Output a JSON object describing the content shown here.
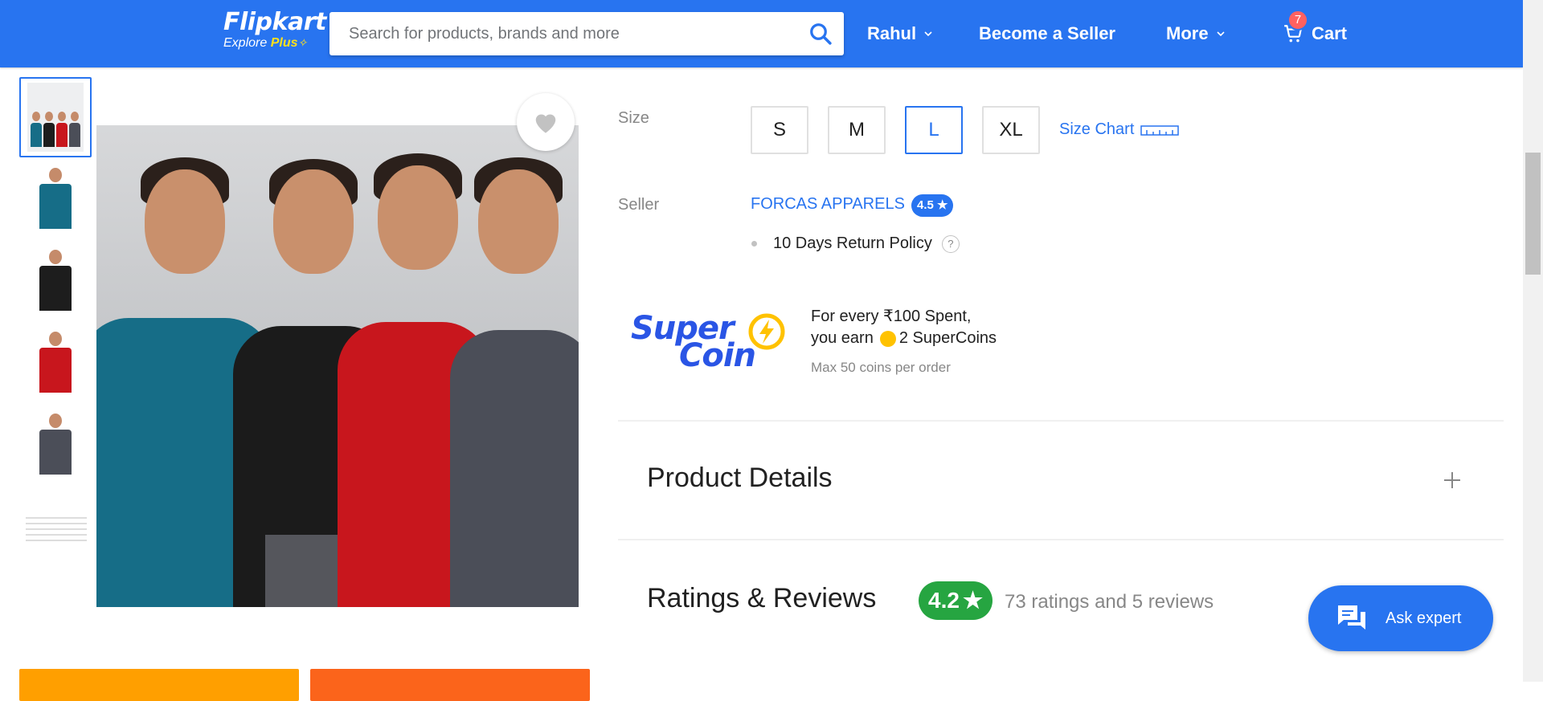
{
  "header": {
    "logo_main": "Flipkart",
    "logo_sub_prefix": "Explore",
    "logo_sub_plus": "Plus",
    "search_placeholder": "Search for products, brands and more",
    "user_label": "Rahul",
    "seller_label": "Become a Seller",
    "more_label": "More",
    "cart_label": "Cart",
    "cart_count": "7"
  },
  "product": {
    "size_label": "Size",
    "sizes": [
      "S",
      "M",
      "L",
      "XL"
    ],
    "selected_size": "L",
    "size_chart_label": "Size Chart",
    "seller_label": "Seller",
    "seller_name": "FORCAS APPARELS",
    "seller_rating": "4.5",
    "return_policy": "10 Days Return Policy",
    "help_icon_text": "?"
  },
  "supercoin": {
    "brand_line1": "Super",
    "brand_line2": "Coin",
    "line1": "For every ₹100 Spent,",
    "line2_prefix": "you earn",
    "line2_suffix": "2 SuperCoins",
    "note": "Max 50 coins per order"
  },
  "sections": {
    "product_details": "Product Details",
    "ratings_reviews": "Ratings & Reviews",
    "overall_rating": "4.2",
    "rating_summary": "73 ratings and 5 reviews"
  },
  "ask_expert_label": "Ask expert",
  "colors": {
    "brand_blue": "#2874f0",
    "rating_green": "#26a541",
    "buy_now_orange": "#fb641b",
    "add_cart_yellow": "#ff9f00"
  },
  "thumbnails": [
    "teal-black-red-grey",
    "teal",
    "black",
    "red",
    "grey",
    "size-chart"
  ]
}
